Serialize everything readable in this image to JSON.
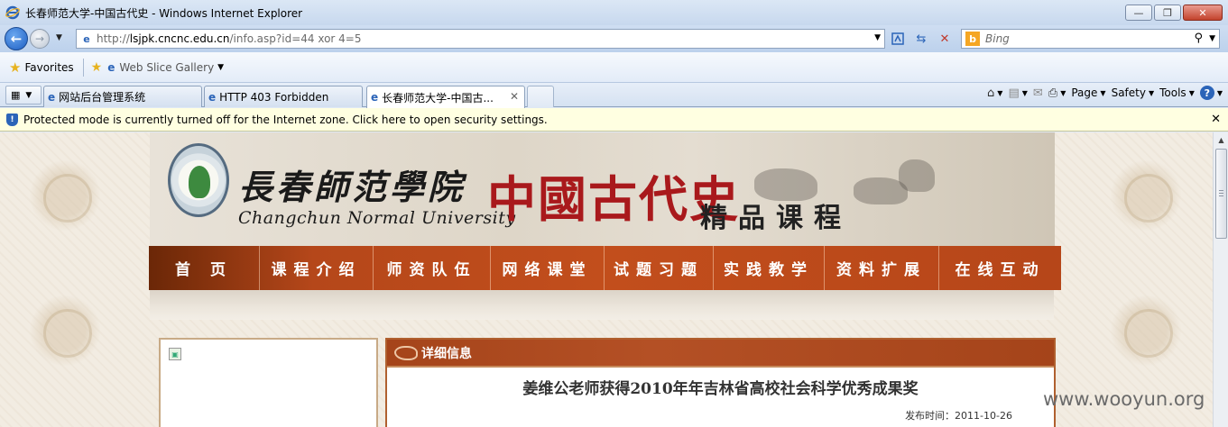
{
  "window": {
    "title": "长春师范大学-中国古代史 - Windows Internet Explorer",
    "controls": {
      "minimize": "—",
      "restore": "❐",
      "close": "✕"
    }
  },
  "nav": {
    "address_host": "lsjpk.cncnc.edu.cn",
    "address_prefix": "http://",
    "address_path": "/info.asp?id=44 xor 4=5",
    "search_placeholder": "Bing",
    "search_logo": "b"
  },
  "favorites": {
    "label": "Favorites",
    "web_slice": "Web Slice Gallery"
  },
  "tabs": [
    {
      "label": "网站后台管理系统"
    },
    {
      "label": "HTTP 403 Forbidden"
    },
    {
      "label": "长春师范大学-中国古..."
    }
  ],
  "commandbar": {
    "page": "Page",
    "safety": "Safety",
    "tools": "Tools",
    "help": "?"
  },
  "infobar": {
    "message": "Protected mode is currently turned off for the Internet zone.  Click here to open security settings."
  },
  "site": {
    "school_cn": "長春師范學院",
    "school_en": "Changchun Normal University",
    "course_title": "中國古代史",
    "course_sub": "精品课程",
    "menu": [
      "首 页",
      "课程介绍",
      "师资队伍",
      "网络课堂",
      "试题习题",
      "实践教学",
      "资料扩展",
      "在线互动"
    ],
    "detail_header": "详细信息",
    "article_title": "姜维公老师获得2010年年吉林省高校社会科学优秀成果奖",
    "article_date": "发布时间：2011-10-26"
  },
  "watermark": "www.wooyun.org",
  "colors": {
    "menu_bar": "#c24e1c",
    "course_title": "#a9191c",
    "infobar_bg": "#ffffe1"
  }
}
